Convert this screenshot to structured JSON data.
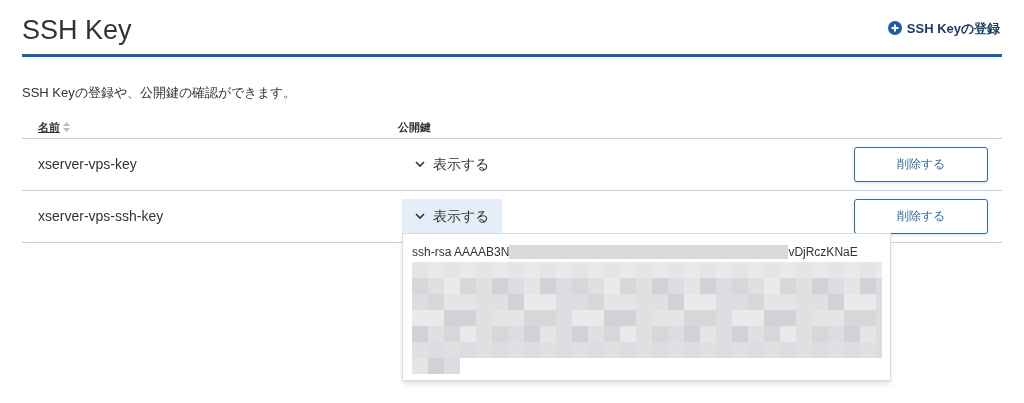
{
  "header": {
    "title": "SSH Key",
    "action": "SSH Keyの登録"
  },
  "description": "SSH Keyの登録や、公開鍵の確認ができます。",
  "table": {
    "columns": [
      {
        "label": "名前",
        "sortable": true
      },
      {
        "label": "公開鍵",
        "sortable": false
      }
    ],
    "rows": [
      {
        "name": "xserver-vps-key",
        "toggle": "表示する",
        "expanded": false,
        "button": "削除する"
      },
      {
        "name": "xserver-vps-ssh-key",
        "toggle": "表示する",
        "expanded": true,
        "button": "削除する",
        "key_start": "ssh-rsa AAAAB3N",
        "key_end": "vDjRczKNaE"
      }
    ]
  }
}
